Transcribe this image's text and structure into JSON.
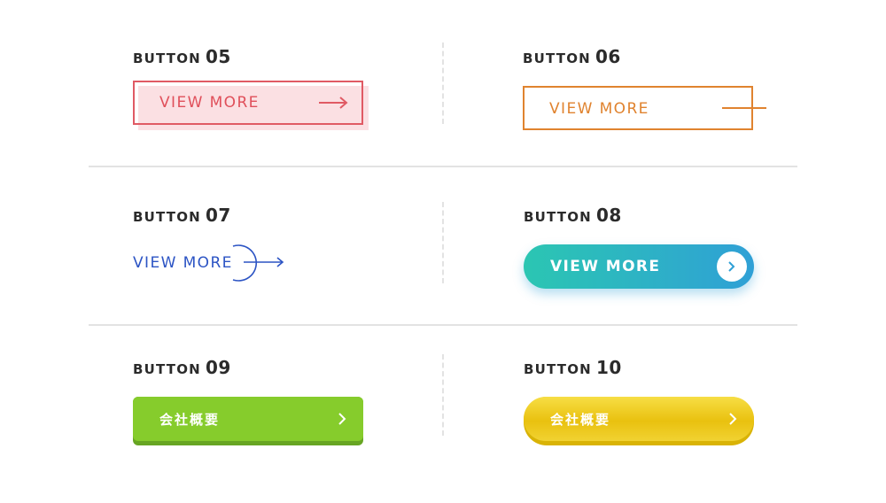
{
  "sections": [
    {
      "word": "BUTTON",
      "number": "05",
      "button_label": "VIEW MORE"
    },
    {
      "word": "BUTTON",
      "number": "06",
      "button_label": "VIEW MORE"
    },
    {
      "word": "BUTTON",
      "number": "07",
      "button_label": "VIEW MORE"
    },
    {
      "word": "BUTTON",
      "number": "08",
      "button_label": "VIEW MORE"
    },
    {
      "word": "BUTTON",
      "number": "09",
      "button_label": "会社概要"
    },
    {
      "word": "BUTTON",
      "number": "10",
      "button_label": "会社概要"
    }
  ],
  "colors": {
    "button05": "#e05a64",
    "button05_shadow": "#fbe0e3",
    "button06": "#e0832f",
    "button07": "#2c54c4",
    "button08_gradient": [
      "#2bc6b2",
      "#2fa0d6"
    ],
    "button09": "#86cc2c",
    "button10": "#e9c10f",
    "divider": "#e3e3e3"
  },
  "icons": {
    "button05": "arrow-right-icon",
    "button06": "line-icon",
    "button07": "circle-arrow-icon",
    "button08": "chevron-right-icon",
    "button09": "chevron-right-icon",
    "button10": "chevron-right-icon"
  }
}
